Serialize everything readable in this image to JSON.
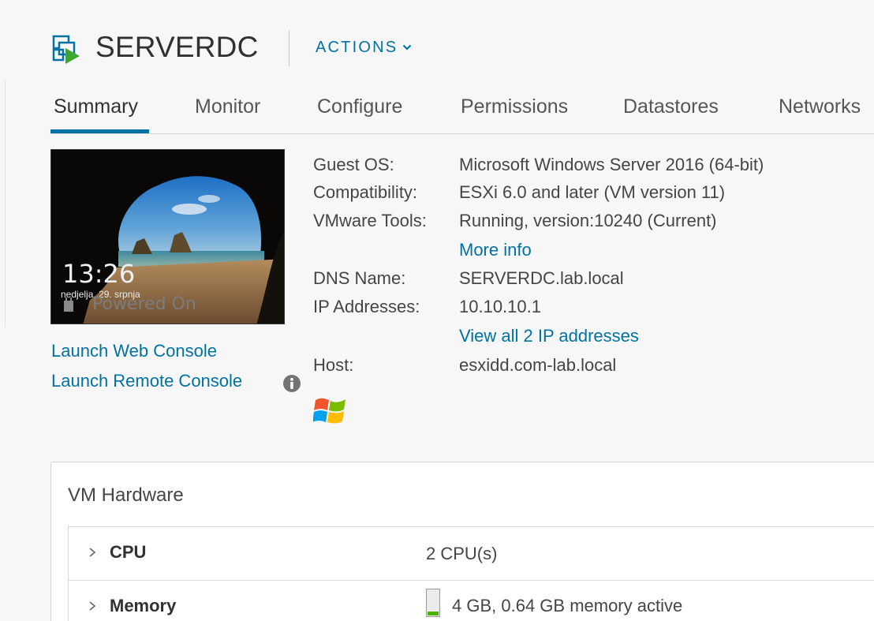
{
  "header": {
    "vm_name": "SERVERDC",
    "actions_label": "ACTIONS",
    "vm_icon": "vm-icon",
    "actions_icon": "chevron-down-icon"
  },
  "tabs": [
    {
      "label": "Summary",
      "active": true
    },
    {
      "label": "Monitor",
      "active": false
    },
    {
      "label": "Configure",
      "active": false
    },
    {
      "label": "Permissions",
      "active": false
    },
    {
      "label": "Datastores",
      "active": false
    },
    {
      "label": "Networks",
      "active": false
    }
  ],
  "console": {
    "time": "13:26",
    "date": "nedjelja, 29. srpnja",
    "status": "Powered On",
    "launch_web_console": "Launch Web Console",
    "launch_remote_console": "Launch Remote Console",
    "info_icon": "info-icon"
  },
  "properties": {
    "guest_os_label": "Guest OS:",
    "guest_os_value": "Microsoft Windows Server 2016 (64-bit)",
    "compatibility_label": "Compatibility:",
    "compatibility_value": "ESXi 6.0 and later (VM version 11)",
    "vmware_tools_label": "VMware Tools:",
    "vmware_tools_value": "Running, version:10240 (Current)",
    "more_info_link": "More info",
    "dns_name_label": "DNS Name:",
    "dns_name_value": "SERVERDC.lab.local",
    "ip_addresses_label": "IP Addresses:",
    "ip_addresses_value": "10.10.10.1",
    "view_all_ips_link": "View all 2 IP addresses",
    "host_label": "Host:",
    "host_value": "esxidd.com-lab.local",
    "os_icon": "windows-logo-icon"
  },
  "vm_hardware": {
    "title": "VM Hardware",
    "rows": [
      {
        "label": "CPU",
        "value": "2 CPU(s)"
      },
      {
        "label": "Memory",
        "value": "4 GB, 0.64 GB memory active",
        "usage_fraction": 0.16
      }
    ],
    "colors": {
      "memory_fill": "#48b400"
    }
  },
  "colors": {
    "link": "#0072a3",
    "tab_underline": "#0072a3",
    "background": "#f7f7f7"
  }
}
